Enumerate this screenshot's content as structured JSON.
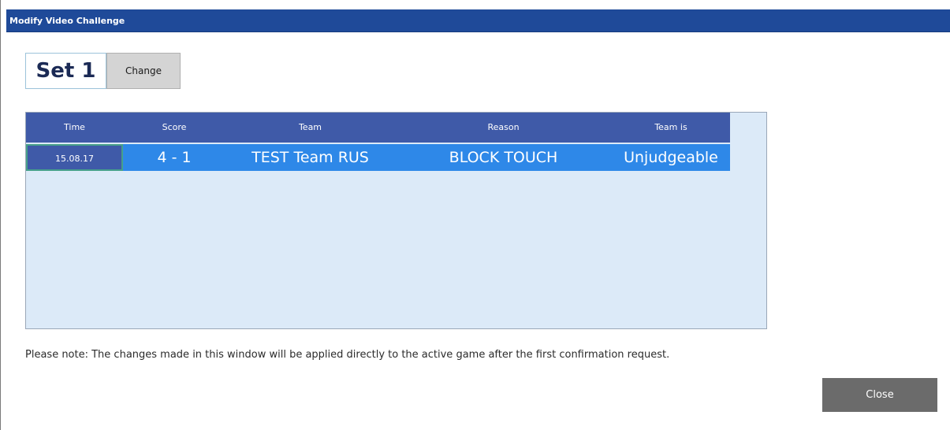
{
  "window": {
    "title": "Modify Video Challenge"
  },
  "set": {
    "label": "Set 1",
    "change_label": "Change"
  },
  "grid": {
    "columns": [
      "Time",
      "Score",
      "Team",
      "Reason",
      "Team is"
    ],
    "rows": [
      {
        "time": "15.08.17",
        "score": "4 - 1",
        "team": "TEST Team RUS",
        "reason": "BLOCK TOUCH",
        "team_is": "Unjudgeable"
      }
    ]
  },
  "note": "Please note: The changes made in this window will be applied directly to the active game after the first confirmation request.",
  "footer": {
    "close_label": "Close"
  },
  "colors": {
    "titlebar": "#1f4a99",
    "header": "#3f5aa8",
    "selected_row": "#2e88e8",
    "panel": "#dceaf8"
  }
}
